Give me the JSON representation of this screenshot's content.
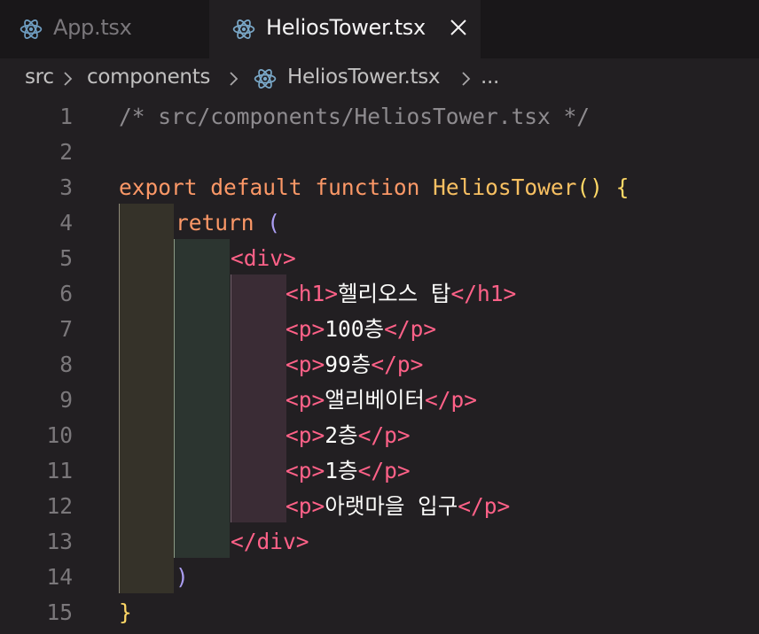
{
  "tabs": [
    {
      "label": "App.tsx",
      "active": false,
      "icon": "react-icon"
    },
    {
      "label": "HeliosTower.tsx",
      "active": true,
      "icon": "react-icon",
      "close_icon": "close-icon"
    }
  ],
  "breadcrumb": {
    "items": [
      "src",
      "components",
      "HeliosTower.tsx",
      "..."
    ],
    "separator_icon": "chevron-right-icon",
    "file_icon": "react-icon"
  },
  "editor": {
    "line_numbers": [
      "1",
      "2",
      "3",
      "4",
      "5",
      "6",
      "7",
      "8",
      "9",
      "10",
      "11",
      "12",
      "13",
      "14",
      "15"
    ],
    "lines": {
      "l1_comment": "/* src/components/HeliosTower.tsx */",
      "l3_export": "export",
      "l3_default": "default",
      "l3_function": "function",
      "l3_name": "HeliosTower",
      "l3_parens": "()",
      "l3_brace": "{",
      "l4_return": "return",
      "l4_paren": "(",
      "l5_open_div": "<div>",
      "l6_open": "<h1>",
      "l6_text": "헬리오스 탑",
      "l6_close": "</h1>",
      "l7_open": "<p>",
      "l7_text": "100층",
      "l7_close": "</p>",
      "l8_open": "<p>",
      "l8_text": "99층",
      "l8_close": "</p>",
      "l9_open": "<p>",
      "l9_text": "앨리베이터",
      "l9_close": "</p>",
      "l10_open": "<p>",
      "l10_text": "2층",
      "l10_close": "</p>",
      "l11_open": "<p>",
      "l11_text": "1층",
      "l11_close": "</p>",
      "l12_open": "<p>",
      "l12_text": "아랫마을 입구",
      "l12_close": "</p>",
      "l13_close_div": "</div>",
      "l14_paren": ")",
      "l15_brace": "}"
    }
  },
  "colors": {
    "background": "#221f22",
    "tabbar": "#191719",
    "comment": "#8e8b8f",
    "keyword": "#fc9867",
    "function_name": "#f8c062",
    "tag": "#ff6188",
    "text": "#fcfcfa",
    "paren": "#ab9df2",
    "brace": "#ffd866",
    "react_icon": "#7aa8c8"
  }
}
